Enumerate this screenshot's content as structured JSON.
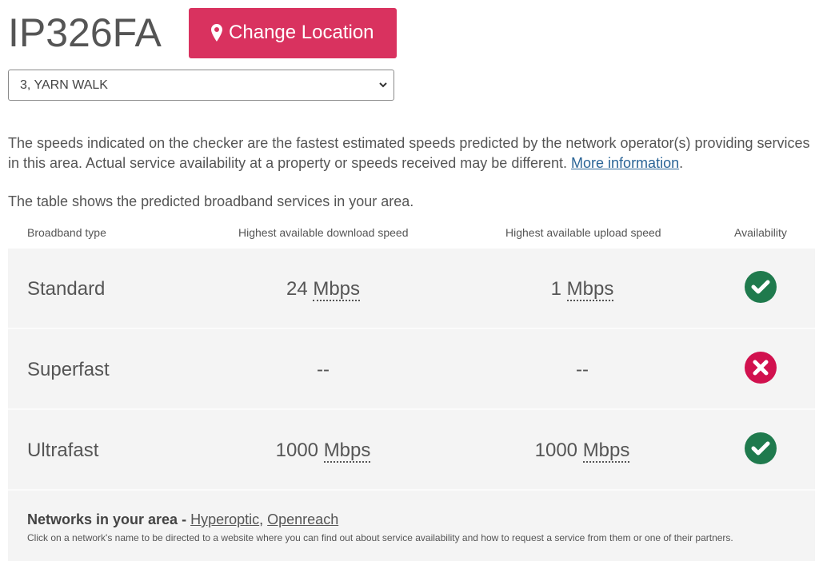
{
  "header": {
    "postcode": "IP326FA",
    "change_location_label": "Change Location"
  },
  "address_select": {
    "selected": "3, YARN WALK"
  },
  "info": {
    "disclaimer": "The speeds indicated on the checker are the fastest estimated speeds predicted by the network operator(s) providing services in this area. Actual service availability at a property or speeds received may be different. ",
    "more_info_link": "More information",
    "more_info_suffix": ".",
    "table_intro": "The table shows the predicted broadband services in your area."
  },
  "table": {
    "headers": [
      "Broadband type",
      "Highest available download speed",
      "Highest available upload speed",
      "Availability"
    ],
    "rows": [
      {
        "type": "Standard",
        "download_value": "24",
        "download_unit": "Mbps",
        "upload_value": "1",
        "upload_unit": "Mbps",
        "available": true
      },
      {
        "type": "Superfast",
        "download_value": "--",
        "download_unit": "",
        "upload_value": "--",
        "upload_unit": "",
        "available": false
      },
      {
        "type": "Ultrafast",
        "download_value": "1000",
        "download_unit": "Mbps",
        "upload_value": "1000",
        "upload_unit": "Mbps",
        "available": true
      }
    ]
  },
  "networks": {
    "label": "Networks in your area - ",
    "links": [
      "Hyperoptic",
      "Openreach"
    ],
    "separator": ", ",
    "note": "Click on a network's name to be directed to a website where you can find out about service availability and how to request a service from them or one of their partners."
  },
  "colors": {
    "brand": "#d9325f",
    "available": "#1f7a4d",
    "unavailable": "#d1114e",
    "link": "#2a6496"
  }
}
